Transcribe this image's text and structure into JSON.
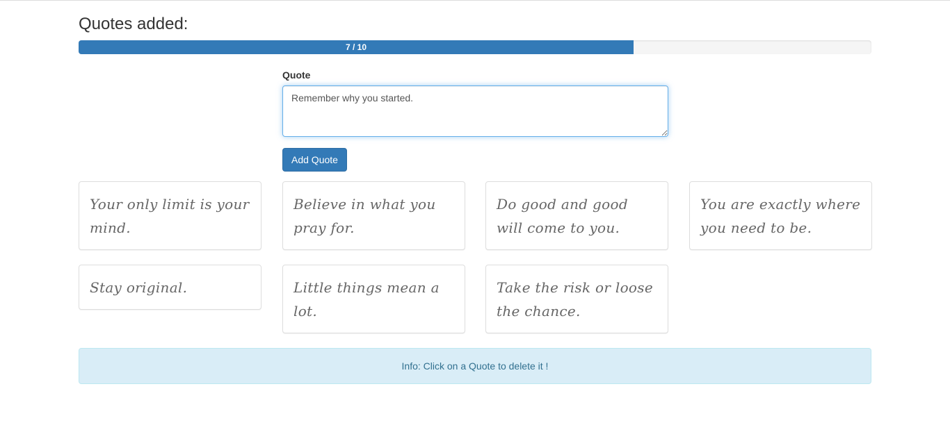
{
  "header": {
    "title": "Quotes added:"
  },
  "progress": {
    "label": "7 / 10",
    "current": 7,
    "max": 10,
    "fraction": 0.7
  },
  "form": {
    "label": "Quote",
    "value": "Remember why you started. ",
    "button_label": "Add Quote"
  },
  "quotes": [
    "Your only limit is your mind.",
    "Believe in what you pray for.",
    "Do good and good will come to you.",
    "You are exactly where you need to be.",
    "Stay original.",
    "Little things mean a lot.",
    "Take the risk or loose the chance."
  ],
  "info": {
    "text": "Info: Click on a Quote to delete it !"
  },
  "colors": {
    "primary": "#337ab7",
    "info_bg": "#d9edf7",
    "info_text": "#31708f"
  }
}
